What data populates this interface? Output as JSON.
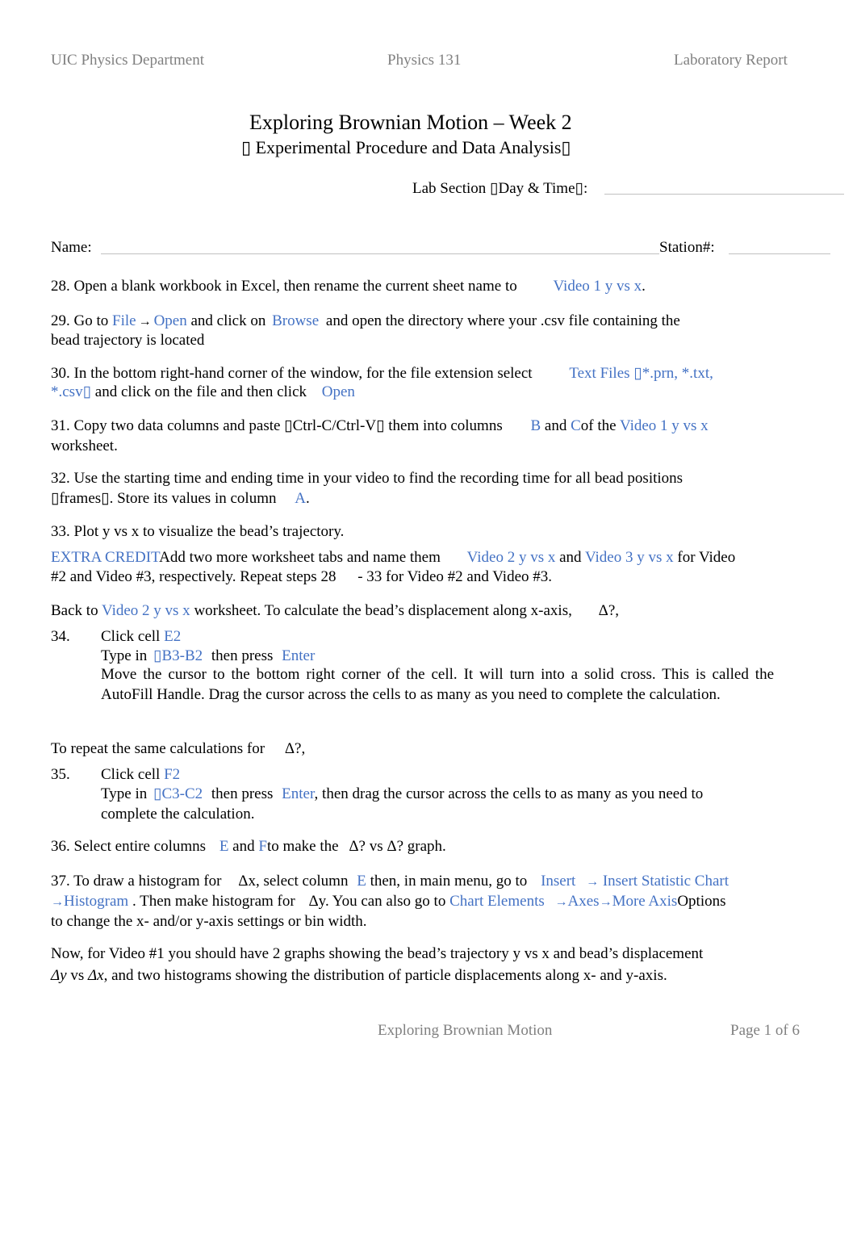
{
  "header": {
    "left": "UIC Physics Department",
    "center": "Physics 131",
    "right": "Laboratory Report"
  },
  "title": {
    "main": "Exploring Brownian Motion – Week 2",
    "sub": "▯ Experimental Procedure and Data Analysis▯"
  },
  "form": {
    "lab_section_label": "Lab Section ▯Day & Time▯:",
    "name_label": "Name:",
    "station_label": "Station#:"
  },
  "steps": {
    "s28": {
      "text": "28. Open a blank workbook in Excel, then rename the current sheet name to",
      "ref": "Video 1 y vs x",
      "end": "."
    },
    "s29": {
      "t1": "29. Go to",
      "file": "File",
      "arrow": "→",
      "open": "Open",
      "t2": "and click on",
      "browse": "Browse",
      "t3": "and open the directory where your .csv file containing the",
      "t4": "bead trajectory is located"
    },
    "s30": {
      "t1": "30. In the bottom right-hand corner of the window, for the file extension select",
      "ext1": "Text Files ▯*.prn, *.txt,",
      "ext2": "*.csv▯",
      "t2": "and click on the file and then click",
      "open": "Open"
    },
    "s31": {
      "t1": "31. Copy two data columns and paste ▯Ctrl-C/Ctrl-V▯ them into columns",
      "colB": "B",
      "and": "and",
      "colC": "C",
      "t2": "of the",
      "ref": "Video 1 y vs x",
      "t3": "worksheet."
    },
    "s32": {
      "t1": "32. Use the starting time and ending time in your video to find the recording time for all bead positions",
      "t2": "▯frames▯. Store its values in column",
      "colA": "A",
      "end": "."
    },
    "s33": {
      "text": "33. Plot y vs x to visualize the bead’s trajectory."
    },
    "extra": {
      "label": "EXTRA CREDIT",
      "t1": "Add two more worksheet tabs and name them",
      "v2": "Video 2 y vs x",
      "and": "and",
      "v3": "Video 3 y vs x",
      "t2": "for Video",
      "t3": "#2 and Video #3, respectively. Repeat steps 28",
      "t4": "- 33 for Video #2 and Video #3."
    },
    "back": {
      "t1": "Back to",
      "ref": "Video 2 y vs x",
      "t2": "worksheet. To calculate the bead’s displacement along x-axis,",
      "delta": "Δ?,"
    },
    "s34": {
      "num": "34.",
      "click": "Click cell",
      "cell": "E2",
      "type": "Type in",
      "formula": "▯B3-B2",
      "press": "then press",
      "enter": "Enter",
      "move": "Move the cursor to the bottom right corner of the cell. It will turn into a solid cross. This is called the AutoFill Handle. Drag the cursor across the cells to as many as you need to complete the calculation."
    },
    "repeat": {
      "t1": "To repeat the same calculations for",
      "delta": "Δ?,"
    },
    "s35": {
      "num": "35.",
      "click": "Click cell",
      "cell": "F2",
      "type": "Type in",
      "formula": "▯C3-C2",
      "press": "then press",
      "enter": "Enter",
      "rest": ", then drag the cursor across the cells to as many as you need to",
      "rest2": "complete the calculation."
    },
    "s36": {
      "t1": "36. Select entire columns",
      "colE": "E",
      "and": "and",
      "colF": "F",
      "t2": "to make the",
      "d1": "Δ? vs",
      "d2": "Δ? graph."
    },
    "s37": {
      "t1": "37. To draw a histogram for",
      "dx": "Δx",
      "t2": ", select column",
      "colE": "E",
      "t3": "then, in main menu, go to",
      "insert": "Insert",
      "arrow": "→",
      "stat": "Insert Statistic Chart",
      "hist": "Histogram",
      "t4": ". Then make histogram for",
      "dy": "Δy",
      "t5": ". You can also go to",
      "chartel": "Chart Elements",
      "axes": "Axes",
      "more": "More Axis",
      "t6": "Options",
      "t7": "to change the x- and/or y-axis settings or bin width."
    },
    "summary": {
      "t1": "Now, for Video #1 you should have 2 graphs showing the bead’s trajectory y vs x and bead’s displacement",
      "dy": "Δy",
      "vs": "vs",
      "dx": "Δx",
      "t2": ", and two histograms showing the distribution of particle displacements along x- and y-axis."
    }
  },
  "footer": {
    "title": "Exploring Brownian Motion",
    "page": "Page 1 of 6"
  }
}
